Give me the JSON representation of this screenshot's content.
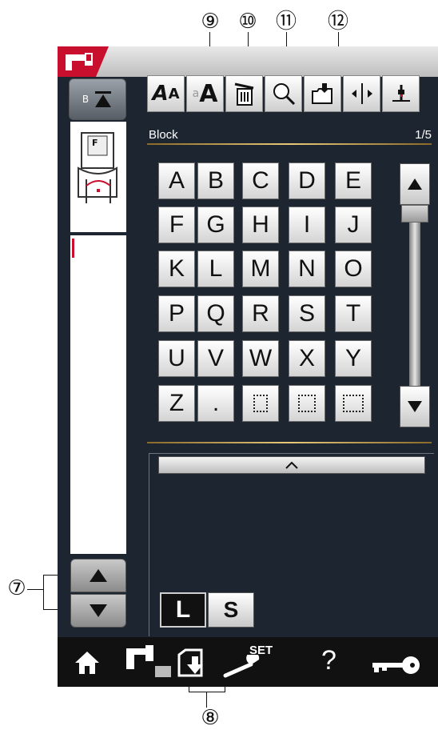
{
  "callouts": {
    "c9": "⑨",
    "c10": "⑩",
    "c11": "⑪",
    "c12": "⑫",
    "c7": "⑦",
    "c8": "⑧"
  },
  "header": {
    "category": "Block",
    "page": "1/5"
  },
  "side": {
    "foot_label": "F",
    "b_label": "B"
  },
  "letters": [
    "A",
    "B",
    "C",
    "D",
    "E",
    "F",
    "G",
    "H",
    "I",
    "J",
    "K",
    "L",
    "M",
    "N",
    "O",
    "P",
    "Q",
    "R",
    "S",
    "T",
    "U",
    "V",
    "W",
    "X",
    "Y",
    "Z",
    "."
  ],
  "size_buttons": {
    "large": "L",
    "small": "S"
  },
  "bottom": {
    "set_label": "SET",
    "help_label": "?"
  }
}
